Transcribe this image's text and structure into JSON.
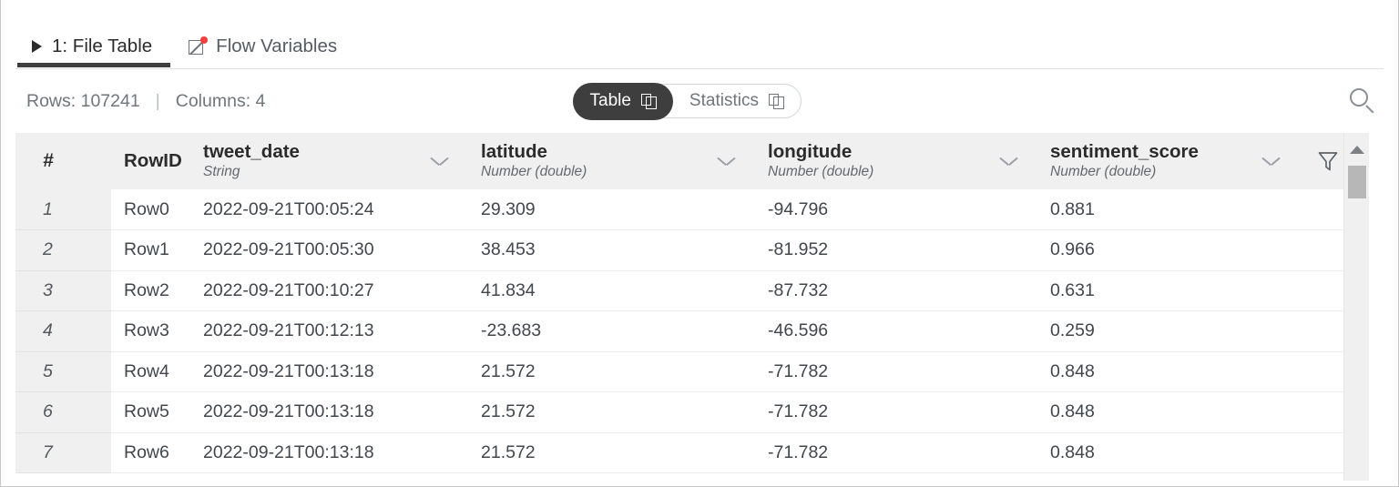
{
  "tabs": [
    {
      "label": "1: File Table",
      "icon": "play-triangle-icon",
      "active": true
    },
    {
      "label": "Flow Variables",
      "icon": "flow-variable-icon",
      "active": false
    }
  ],
  "toolbar": {
    "rows_label": "Rows: 107241",
    "separator": "|",
    "columns_label": "Columns: 4",
    "view_toggle": [
      {
        "label": "Table",
        "icon": "copy-icon",
        "active": true
      },
      {
        "label": "Statistics",
        "icon": "copy-icon",
        "active": false
      }
    ],
    "search_icon": "search-icon"
  },
  "table": {
    "columns": [
      {
        "name": "#",
        "type": "",
        "kind": "index"
      },
      {
        "name": "RowID",
        "type": "",
        "kind": "rowid"
      },
      {
        "name": "tweet_date",
        "type": "String",
        "kind": "data"
      },
      {
        "name": "latitude",
        "type": "Number (double)",
        "kind": "data"
      },
      {
        "name": "longitude",
        "type": "Number (double)",
        "kind": "data"
      },
      {
        "name": "sentiment_score",
        "type": "Number (double)",
        "kind": "data"
      }
    ],
    "filter_icon": "filter-funnel-icon",
    "rows": [
      {
        "index": "1",
        "rowid": "Row0",
        "tweet_date": "2022-09-21T00:05:24",
        "latitude": "29.309",
        "longitude": "-94.796",
        "sentiment_score": "0.881"
      },
      {
        "index": "2",
        "rowid": "Row1",
        "tweet_date": "2022-09-21T00:05:30",
        "latitude": "38.453",
        "longitude": "-81.952",
        "sentiment_score": "0.966"
      },
      {
        "index": "3",
        "rowid": "Row2",
        "tweet_date": "2022-09-21T00:10:27",
        "latitude": "41.834",
        "longitude": "-87.732",
        "sentiment_score": "0.631"
      },
      {
        "index": "4",
        "rowid": "Row3",
        "tweet_date": "2022-09-21T00:12:13",
        "latitude": "-23.683",
        "longitude": "-46.596",
        "sentiment_score": "0.259"
      },
      {
        "index": "5",
        "rowid": "Row4",
        "tweet_date": "2022-09-21T00:13:18",
        "latitude": "21.572",
        "longitude": "-71.782",
        "sentiment_score": "0.848"
      },
      {
        "index": "6",
        "rowid": "Row5",
        "tweet_date": "2022-09-21T00:13:18",
        "latitude": "21.572",
        "longitude": "-71.782",
        "sentiment_score": "0.848"
      },
      {
        "index": "7",
        "rowid": "Row6",
        "tweet_date": "2022-09-21T00:13:18",
        "latitude": "21.572",
        "longitude": "-71.782",
        "sentiment_score": "0.848"
      }
    ]
  },
  "scrollbar": {
    "up_arrow_icon": "scroll-up-arrow-icon",
    "thumb": "scroll-thumb"
  },
  "colors": {
    "accent_dark": "#3e3e3e",
    "header_bg": "#f0f0f0",
    "text": "#41474d",
    "muted": "#6f767c",
    "notification_dot": "#fc3d39"
  }
}
